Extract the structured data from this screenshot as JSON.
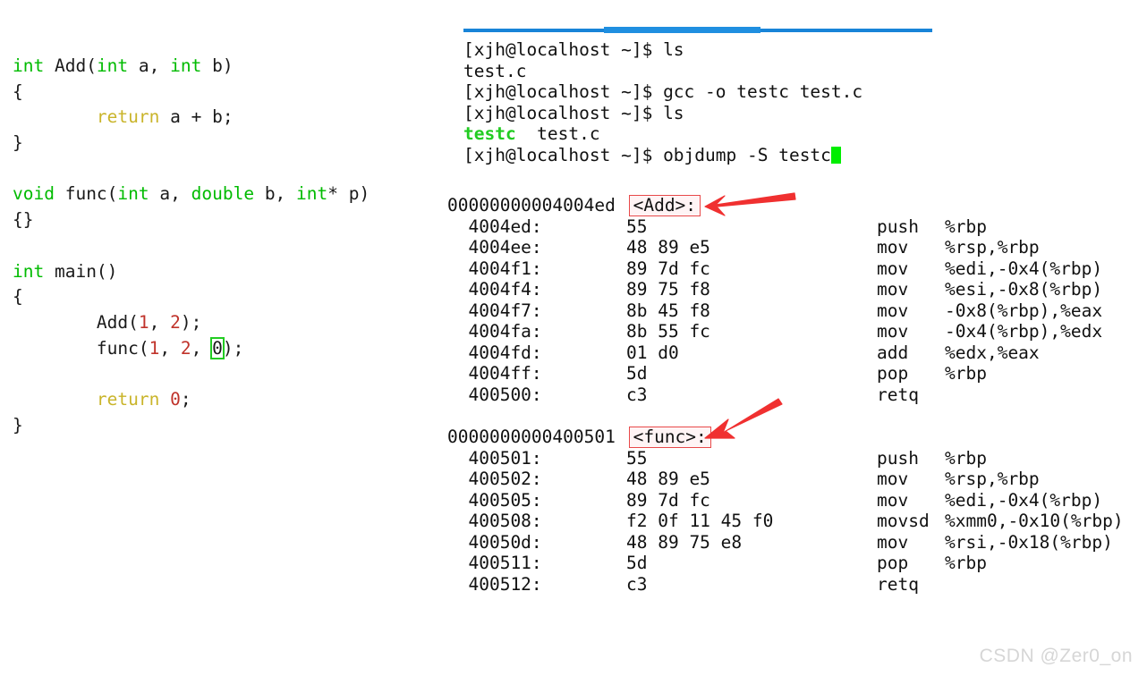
{
  "editor": {
    "code_lines": [
      [
        {
          "t": "int",
          "c": "kw"
        },
        {
          "t": " Add(",
          "c": "pln"
        },
        {
          "t": "int",
          "c": "kw"
        },
        {
          "t": " a, ",
          "c": "pln"
        },
        {
          "t": "int",
          "c": "kw"
        },
        {
          "t": " b)",
          "c": "pln"
        }
      ],
      [
        {
          "t": "{",
          "c": "pln"
        }
      ],
      [
        {
          "t": "        ",
          "c": "pln"
        },
        {
          "t": "return",
          "c": "ret"
        },
        {
          "t": " a + b;",
          "c": "pln"
        }
      ],
      [
        {
          "t": "}",
          "c": "pln"
        }
      ],
      [
        {
          "t": "",
          "c": "pln"
        }
      ],
      [
        {
          "t": "void",
          "c": "kw"
        },
        {
          "t": " func(",
          "c": "pln"
        },
        {
          "t": "int",
          "c": "kw"
        },
        {
          "t": " a, ",
          "c": "pln"
        },
        {
          "t": "double",
          "c": "kw"
        },
        {
          "t": " b, ",
          "c": "pln"
        },
        {
          "t": "int",
          "c": "kw"
        },
        {
          "t": "* p)",
          "c": "pln"
        }
      ],
      [
        {
          "t": "{}",
          "c": "pln"
        }
      ],
      [
        {
          "t": "",
          "c": "pln"
        }
      ],
      [
        {
          "t": "int",
          "c": "kw"
        },
        {
          "t": " main()",
          "c": "pln"
        }
      ],
      [
        {
          "t": "{",
          "c": "pln"
        }
      ],
      [
        {
          "t": "        Add(",
          "c": "pln"
        },
        {
          "t": "1",
          "c": "num"
        },
        {
          "t": ", ",
          "c": "pln"
        },
        {
          "t": "2",
          "c": "num"
        },
        {
          "t": ");",
          "c": "pln"
        }
      ],
      [
        {
          "t": "        func(",
          "c": "pln"
        },
        {
          "t": "1",
          "c": "num"
        },
        {
          "t": ", ",
          "c": "pln"
        },
        {
          "t": "2",
          "c": "num"
        },
        {
          "t": ", ",
          "c": "pln"
        },
        {
          "t": "0",
          "c": "brkt-hl"
        },
        {
          "t": ");",
          "c": "pln"
        }
      ],
      [
        {
          "t": "",
          "c": "pln"
        }
      ],
      [
        {
          "t": "        ",
          "c": "pln"
        },
        {
          "t": "return",
          "c": "ret"
        },
        {
          "t": " ",
          "c": "pln"
        },
        {
          "t": "0",
          "c": "num"
        },
        {
          "t": ";",
          "c": "pln"
        }
      ],
      [
        {
          "t": "}",
          "c": "pln"
        }
      ]
    ],
    "bracket_highlight_value": "0",
    "keyword_color": "#00bb00",
    "return_color": "#c9b42a",
    "number_color": "#c0332b"
  },
  "terminal": {
    "prompt": "[xjh@localhost ~]$",
    "accent_bar_color": "#1884d8",
    "cursor_color": "#00ee00",
    "lines": [
      {
        "type": "command",
        "prompt": "[xjh@localhost ~]$",
        "command": " ls"
      },
      {
        "type": "output",
        "text": "test.c"
      },
      {
        "type": "command",
        "prompt": "[xjh@localhost ~]$",
        "command": " gcc -o testc test.c"
      },
      {
        "type": "command",
        "prompt": "[xjh@localhost ~]$",
        "command": " ls"
      },
      {
        "type": "output_colored",
        "green": "testc",
        "plain": "  test.c"
      },
      {
        "type": "command_cursor",
        "prompt": "[xjh@localhost ~]$",
        "command": " objdump -S testc"
      }
    ]
  },
  "disassembly": {
    "blocks": [
      {
        "header_address": "00000000004004ed",
        "symbol": "<Add>:",
        "rows": [
          {
            "addr": "  4004ed:",
            "bytes": "55",
            "mnemonic": "push",
            "operands": "%rbp"
          },
          {
            "addr": "  4004ee:",
            "bytes": "48 89 e5",
            "mnemonic": "mov",
            "operands": "%rsp,%rbp"
          },
          {
            "addr": "  4004f1:",
            "bytes": "89 7d fc",
            "mnemonic": "mov",
            "operands": "%edi,-0x4(%rbp)"
          },
          {
            "addr": "  4004f4:",
            "bytes": "89 75 f8",
            "mnemonic": "mov",
            "operands": "%esi,-0x8(%rbp)"
          },
          {
            "addr": "  4004f7:",
            "bytes": "8b 45 f8",
            "mnemonic": "mov",
            "operands": "-0x8(%rbp),%eax"
          },
          {
            "addr": "  4004fa:",
            "bytes": "8b 55 fc",
            "mnemonic": "mov",
            "operands": "-0x4(%rbp),%edx"
          },
          {
            "addr": "  4004fd:",
            "bytes": "01 d0",
            "mnemonic": "add",
            "operands": "%edx,%eax"
          },
          {
            "addr": "  4004ff:",
            "bytes": "5d",
            "mnemonic": "pop",
            "operands": "%rbp"
          },
          {
            "addr": "  400500:",
            "bytes": "c3",
            "mnemonic": "retq",
            "operands": ""
          }
        ]
      },
      {
        "header_address": "0000000000400501",
        "symbol": "<func>:",
        "rows": [
          {
            "addr": "  400501:",
            "bytes": "55",
            "mnemonic": "push",
            "operands": "%rbp"
          },
          {
            "addr": "  400502:",
            "bytes": "48 89 e5",
            "mnemonic": "mov",
            "operands": "%rsp,%rbp"
          },
          {
            "addr": "  400505:",
            "bytes": "89 7d fc",
            "mnemonic": "mov",
            "operands": "%edi,-0x4(%rbp)"
          },
          {
            "addr": "  400508:",
            "bytes": "f2 0f 11 45 f0",
            "mnemonic": "movsd",
            "operands": "%xmm0,-0x10(%rbp)"
          },
          {
            "addr": "  40050d:",
            "bytes": "48 89 75 e8",
            "mnemonic": "mov",
            "operands": "%rsi,-0x18(%rbp)"
          },
          {
            "addr": "  400511:",
            "bytes": "5d",
            "mnemonic": "pop",
            "operands": "%rbp"
          },
          {
            "addr": "  400512:",
            "bytes": "c3",
            "mnemonic": "retq",
            "operands": ""
          }
        ]
      }
    ],
    "symbol_box_color": "#e8494a"
  },
  "annotations": {
    "arrow_color": "#f03030",
    "arrows": [
      {
        "target": "<Add>:",
        "direction": "left"
      },
      {
        "target": "<func>:",
        "direction": "down-left"
      }
    ]
  },
  "watermark": {
    "text": "CSDN @Zer0_on"
  }
}
